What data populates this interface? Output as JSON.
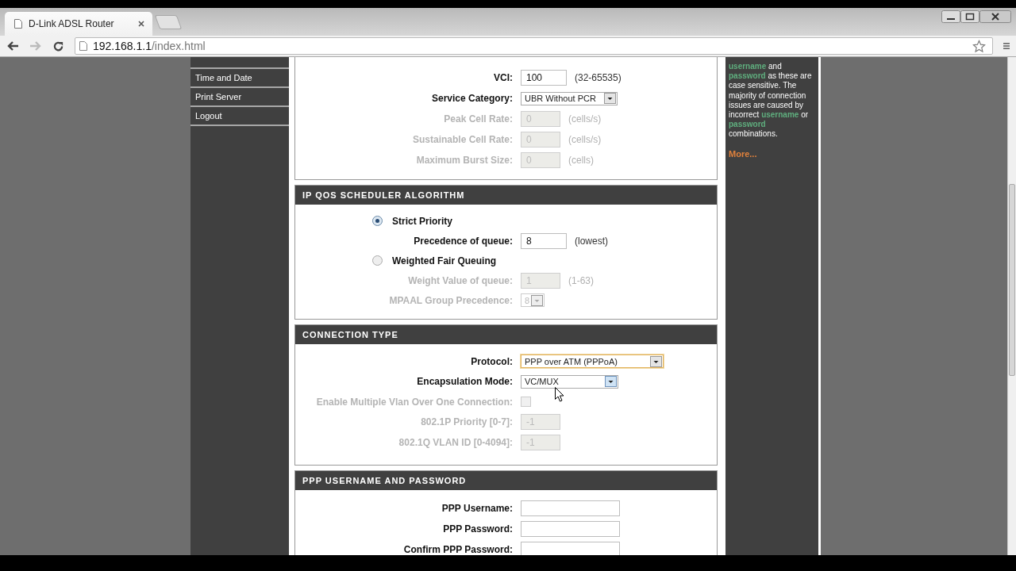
{
  "browser": {
    "tab_title": "D-Link ADSL Router",
    "url_host": "192.168.1.1",
    "url_path": "/index.html"
  },
  "nav": {
    "items": [
      {
        "label": "Time and Date"
      },
      {
        "label": "Print Server"
      },
      {
        "label": "Logout"
      }
    ]
  },
  "sections": [
    {
      "rows": [
        {
          "kind": "text",
          "label": "VCI:",
          "value": "100",
          "hint": "(32-65535)",
          "disabled": false
        },
        {
          "kind": "select",
          "label": "Service Category:",
          "value": "UBR Without PCR",
          "disabled": false,
          "focused": false
        },
        {
          "kind": "text",
          "label": "Peak Cell Rate:",
          "value": "0",
          "hint": "(cells/s)",
          "disabled": true
        },
        {
          "kind": "text",
          "label": "Sustainable Cell Rate:",
          "value": "0",
          "hint": "(cells/s)",
          "disabled": true
        },
        {
          "kind": "text",
          "label": "Maximum Burst Size:",
          "value": "0",
          "hint": "(cells)",
          "disabled": true
        }
      ]
    },
    {
      "title": "IP QOS SCHEDULER ALGORITHM",
      "rows": [
        {
          "kind": "radio",
          "label": "Strict Priority",
          "selected": true
        },
        {
          "kind": "text",
          "label": "Precedence of queue:",
          "value": "8",
          "hint": "(lowest)",
          "disabled": false
        },
        {
          "kind": "radio",
          "label": "Weighted Fair Queuing",
          "selected": false
        },
        {
          "kind": "text",
          "label": "Weight Value of queue:",
          "value": "1",
          "hint": "(1-63)",
          "disabled": true
        },
        {
          "kind": "select",
          "label": "MPAAL Group Precedence:",
          "value": "8",
          "disabled": true,
          "focused": false
        }
      ]
    },
    {
      "title": "CONNECTION TYPE",
      "rows": [
        {
          "kind": "select",
          "label": "Protocol:",
          "value": "PPP over ATM (PPPoA)",
          "disabled": false,
          "focused": true
        },
        {
          "kind": "select",
          "label": "Encapsulation Mode:",
          "value": "VC/MUX",
          "disabled": false,
          "focused": false
        },
        {
          "kind": "checkbox",
          "label": "Enable Multiple Vlan Over One Connection:",
          "checked": false,
          "disabled": true
        },
        {
          "kind": "text",
          "label": "802.1P Priority [0-7]:",
          "value": "-1",
          "disabled": true
        },
        {
          "kind": "text",
          "label": "802.1Q VLAN ID [0-4094]:",
          "value": "-1",
          "disabled": true
        }
      ]
    },
    {
      "title": "PPP USERNAME AND PASSWORD",
      "rows": [
        {
          "kind": "text",
          "label": "PPP Username:",
          "disabled": false
        },
        {
          "kind": "text",
          "label": "PPP Password:",
          "disabled": false
        },
        {
          "kind": "text",
          "label": "Confirm PPP Password:",
          "disabled": false
        }
      ]
    }
  ],
  "help": {
    "segments": [
      {
        "text": "username",
        "highlight": true
      },
      {
        "text": " and ",
        "highlight": false
      },
      {
        "text": "password",
        "highlight": true
      },
      {
        "text": " as these are case sensitive. The majority of connection issues are caused by incorrect ",
        "highlight": false
      },
      {
        "text": "username",
        "highlight": true
      },
      {
        "text": " or ",
        "highlight": false
      },
      {
        "text": "password",
        "highlight": true
      },
      {
        "text": " combinations.",
        "highlight": false
      }
    ],
    "more_link": "More..."
  }
}
